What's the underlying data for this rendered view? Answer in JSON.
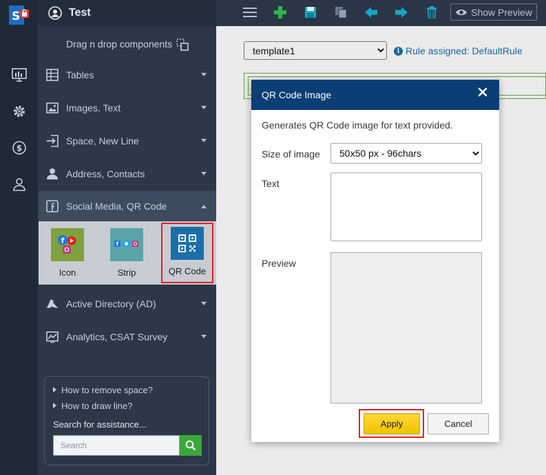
{
  "app": {
    "title": "Test",
    "logo_icon": "signature-app-logo-icon"
  },
  "rail": {
    "items": [
      {
        "icon": "dashboard-icon"
      },
      {
        "icon": "gear-icon"
      },
      {
        "icon": "dollar-icon"
      },
      {
        "icon": "user-icon"
      }
    ]
  },
  "panel": {
    "dnd_label": "Drag n drop components",
    "categories": [
      {
        "label": "Tables",
        "icon": "table-icon"
      },
      {
        "label": "Images, Text",
        "icon": "image-icon"
      },
      {
        "label": "Space, New Line",
        "icon": "arrow-into-box-icon"
      },
      {
        "label": "Address, Contacts",
        "icon": "person-icon"
      },
      {
        "label": "Social Media, QR Code",
        "icon": "facebook-icon",
        "expanded": true
      },
      {
        "label": "Active Directory (AD)",
        "icon": "azure-icon"
      },
      {
        "label": "Analytics, CSAT Survey",
        "icon": "analytics-icon"
      }
    ],
    "tiles": [
      {
        "label": "Icon"
      },
      {
        "label": "Strip"
      },
      {
        "label": "QR Code",
        "selected": true
      }
    ],
    "help": {
      "q1": "How to remove space?",
      "q2": "How to draw line?",
      "search_label": "Search for assistance...",
      "search_placeholder": "Search"
    }
  },
  "toolbar": {
    "icons": [
      "menu-icon",
      "add-icon",
      "save-icon",
      "copy-icon",
      "back-arrow-icon",
      "forward-arrow-icon",
      "trash-icon"
    ],
    "preview_label": "Show Preview"
  },
  "editor": {
    "template_selected": "template1",
    "rule_text": "Rule assigned: DefaultRule"
  },
  "modal": {
    "title": "QR Code Image",
    "description": "Generates QR Code image for text provided.",
    "size_label": "Size of image",
    "size_selected": "50x50 px - 96chars",
    "text_label": "Text",
    "preview_label": "Preview",
    "apply_label": "Apply",
    "cancel_label": "Cancel"
  },
  "colors": {
    "header_blue": "#0b3e74",
    "sidebar_dark": "#2c3747",
    "apply_yellow": "#f2c200",
    "highlight_red": "#e31e24",
    "toolbar_green": "#2fb34a",
    "toolbar_teal": "#16a6c9"
  }
}
